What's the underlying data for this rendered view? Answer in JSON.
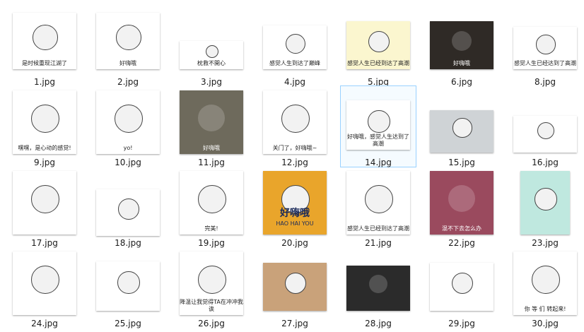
{
  "files": [
    {
      "name": "1.jpg",
      "caption": "是时候重现江湖了",
      "bg": "#ffffff"
    },
    {
      "name": "2.jpg",
      "caption": "好嗨哦",
      "bg": "#ffffff"
    },
    {
      "name": "3.jpg",
      "caption": "枕救不開心",
      "bg": "#ffffff"
    },
    {
      "name": "4.jpg",
      "caption": "感觉人生到达了巅峰",
      "bg": "#ffffff"
    },
    {
      "name": "5.jpg",
      "caption": "感觉人生已经到达了高潮",
      "bg": "#fbf6cf"
    },
    {
      "name": "6.jpg",
      "caption": "好嗨哦",
      "bg": "#2f2a26"
    },
    {
      "name": "8.jpg",
      "caption": "感觉人生已经达到了高潮",
      "bg": "#ffffff"
    },
    {
      "name": "9.jpg",
      "caption": "嘿嘿，是心动的感觉!",
      "bg": "#ffffff"
    },
    {
      "name": "10.jpg",
      "caption": "yo!",
      "bg": "#ffffff"
    },
    {
      "name": "11.jpg",
      "caption": "好嗨哦",
      "bg": "#6e6a5c"
    },
    {
      "name": "12.jpg",
      "caption": "关门了，好嗨哦~",
      "bg": "#ffffff"
    },
    {
      "name": "14.jpg",
      "caption": "好嗨哦，感觉人生达到了高潮",
      "bg": "#ffffff"
    },
    {
      "name": "15.jpg",
      "caption": "",
      "bg": "#cfd3d6"
    },
    {
      "name": "16.jpg",
      "caption": "",
      "bg": "#ffffff"
    },
    {
      "name": "17.jpg",
      "caption": "",
      "bg": "#ffffff"
    },
    {
      "name": "18.jpg",
      "caption": "",
      "bg": "#ffffff"
    },
    {
      "name": "19.jpg",
      "caption": "完美!",
      "bg": "#ffffff"
    },
    {
      "name": "20.jpg",
      "caption": "好嗨哦",
      "sub": "HAO HAI YOU",
      "bg": "#e9a52b"
    },
    {
      "name": "21.jpg",
      "caption": "感觉人生已经到达了高潮",
      "bg": "#ffffff"
    },
    {
      "name": "22.jpg",
      "caption": "混不下去怎么办",
      "bg": "#9a4a5e"
    },
    {
      "name": "23.jpg",
      "caption": "",
      "bg": "#bfe8df"
    },
    {
      "name": "24.jpg",
      "caption": "",
      "bg": "#ffffff"
    },
    {
      "name": "25.jpg",
      "caption": "",
      "bg": "#ffffff"
    },
    {
      "name": "26.jpg",
      "caption": "降温让我觉得TA在冲冲我诶",
      "bg": "#ffffff"
    },
    {
      "name": "27.jpg",
      "caption": "",
      "bg": "#c9a27a"
    },
    {
      "name": "28.jpg",
      "caption": "",
      "bg": "#2b2b2b"
    },
    {
      "name": "29.jpg",
      "caption": "",
      "bg": "#ffffff"
    },
    {
      "name": "30.jpg",
      "caption": "你 等 们 转起来!",
      "bg": "#ffffff"
    }
  ],
  "selected_file": "14.jpg"
}
